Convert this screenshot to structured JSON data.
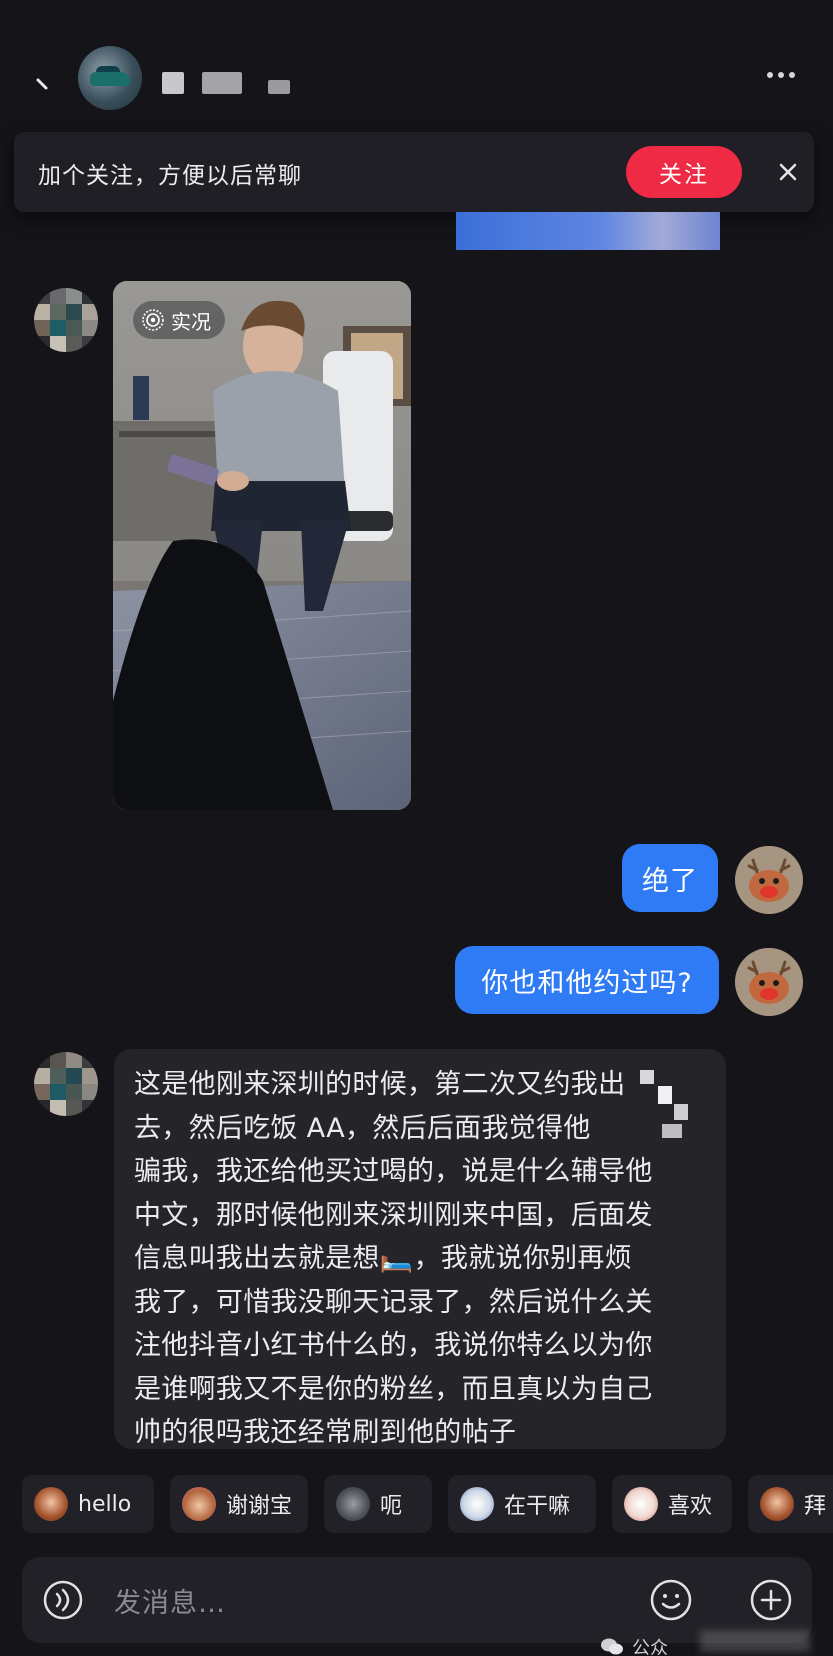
{
  "header": {
    "back_glyph": "、",
    "more_label": "more-options"
  },
  "follow_banner": {
    "text": "加个关注，方便以后常聊",
    "button_label": "关注"
  },
  "messages": {
    "photo_tag": "实况",
    "reply_1": "绝了",
    "reply_2": "你也和他约过吗?",
    "long_reply": "这是他刚来深圳的时候，第二次又约我出\n去，然后吃饭 AA，然后后面我觉得他\n骗我，我还给他买过喝的，说是什么辅导他\n中文，那时候他刚来深圳刚来中国，后面发\n信息叫我出去就是想🛏️，我就说你别再烦\n我了，可惜我没聊天记录了，然后说什么关\n注他抖音小红书什么的，我说你特么以为你\n是谁啊我又不是你的粉丝，而且真以为自己\n帅的很吗我还经常刷到他的帖子"
  },
  "quick_replies": [
    {
      "label": "hello",
      "icon": "monkey-emoji"
    },
    {
      "label": "谢谢宝",
      "icon": "monkey-flower-emoji"
    },
    {
      "label": "呃",
      "icon": "cat-emoji"
    },
    {
      "label": "在干嘛",
      "icon": "peek-emoji"
    },
    {
      "label": "喜欢",
      "icon": "bunny-emoji"
    },
    {
      "label": "拜",
      "icon": "monkey-cover-emoji"
    }
  ],
  "input": {
    "placeholder": "发消息…"
  },
  "watermark": {
    "text": "公众"
  },
  "colors": {
    "background": "#141419",
    "bubble_self": "#2f7bf5",
    "bubble_other": "#242429",
    "follow_button": "#ee2a45"
  }
}
